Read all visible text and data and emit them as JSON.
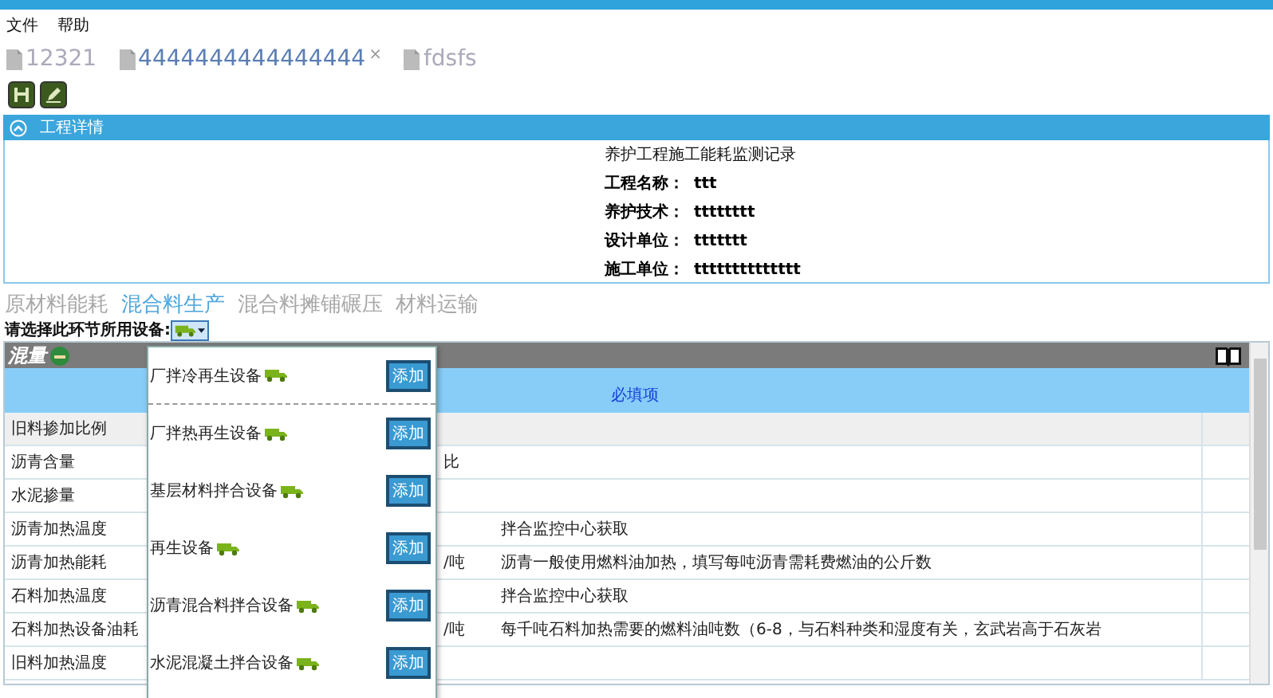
{
  "menu": [
    "文件",
    "帮助"
  ],
  "doc_tabs": [
    {
      "label": "12321",
      "selected": false
    },
    {
      "label": "4444444444444444",
      "selected": true,
      "close": "×"
    },
    {
      "label": "fdsfs",
      "selected": false
    }
  ],
  "panel": {
    "title": "工程详情",
    "expanded": true,
    "heading": "养护工程施工能耗监测记录",
    "fields": [
      {
        "label": "工程名称：",
        "value": "ttt"
      },
      {
        "label": "养护技术：",
        "value": "tttttttt"
      },
      {
        "label": "设计单位：",
        "value": "ttttttt"
      },
      {
        "label": "施工单位：",
        "value": "tttttttttttttt"
      }
    ]
  },
  "section_tabs": [
    {
      "label": "原材料能耗",
      "selected": false
    },
    {
      "label": "混合料生产",
      "selected": true
    },
    {
      "label": "混合料摊铺碾压",
      "selected": false
    },
    {
      "label": "材料运输",
      "selected": false
    }
  ],
  "equipment_picker": {
    "label": "请选择此环节所用设备:",
    "expanded": true,
    "options": [
      {
        "name": "厂拌冷再生设备",
        "action": "添加"
      },
      {
        "name": "厂拌热再生设备",
        "action": "添加"
      },
      {
        "name": "基层材料拌合设备",
        "action": "添加"
      },
      {
        "name": "再生设备",
        "action": "添加"
      },
      {
        "name": "沥青混合料拌合设备",
        "action": "添加"
      },
      {
        "name": "水泥混凝土拌合设备",
        "action": "添加"
      }
    ]
  },
  "table": {
    "title": "混量",
    "required_note": "必填项",
    "rows": [
      {
        "label": "旧料掺加比例",
        "selected": true
      },
      {
        "label": "沥青含量",
        "selected": false,
        "column_3": "比"
      },
      {
        "label": "水泥掺量",
        "selected": false
      },
      {
        "label": "沥青加热温度",
        "selected": false,
        "column_4": "拌合监控中心获取"
      },
      {
        "label": "沥青加热能耗",
        "selected": false,
        "column_3": "/吨",
        "column_4": "沥青一般使用燃料油加热，填写每吨沥青需耗费燃油的公斤数"
      },
      {
        "label": "石料加热温度",
        "selected": false,
        "column_4": "拌合监控中心获取"
      },
      {
        "label": "石料加热设备油耗",
        "selected": false,
        "column_3": "/吨",
        "column_4": "每千吨石料加热需要的燃料油吨数（6-8，与石料种类和湿度有关，玄武岩高于石灰岩"
      },
      {
        "label": "旧料加热温度",
        "selected": false
      }
    ]
  }
}
